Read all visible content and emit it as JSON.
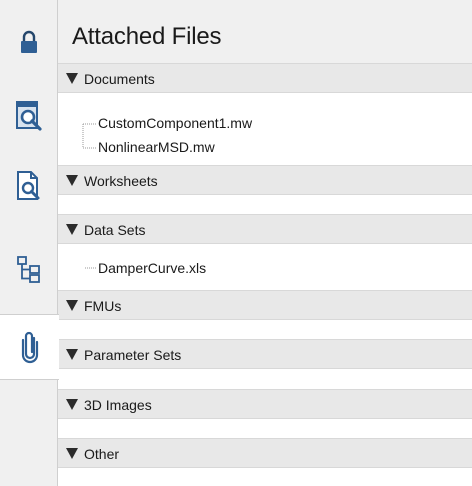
{
  "panel": {
    "title": "Attached Files"
  },
  "toolbar": {
    "tools": [
      {
        "icon": "lock-icon"
      },
      {
        "icon": "document-preview-icon"
      },
      {
        "icon": "document-search-icon"
      },
      {
        "icon": "hierarchy-tree-icon"
      },
      {
        "icon": "paperclip-icon",
        "active": true
      }
    ]
  },
  "sections": [
    {
      "label": "Documents",
      "items": [
        "CustomComponent1.mw",
        "NonlinearMSD.mw"
      ]
    },
    {
      "label": "Worksheets",
      "items": []
    },
    {
      "label": "Data Sets",
      "items": [
        "DamperCurve.xls"
      ]
    },
    {
      "label": "FMUs",
      "items": []
    },
    {
      "label": "Parameter Sets",
      "items": []
    },
    {
      "label": "3D Images",
      "items": []
    },
    {
      "label": "Other",
      "items": []
    }
  ],
  "colors": {
    "icon_blue": "#3a6ea5",
    "icon_dark": "#24466b"
  }
}
